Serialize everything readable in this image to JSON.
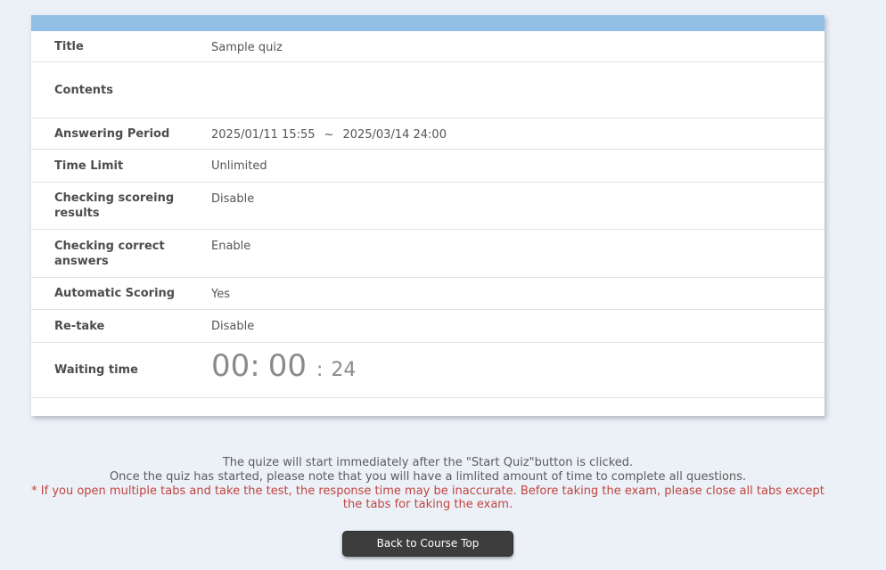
{
  "colors": {
    "page_background": "#ecf0f7",
    "card_header_blue": "#92bfe6",
    "warning_red": "#c0453f",
    "button_background": "#3d3d3d",
    "timer_gray": "#8a8a8a"
  },
  "card": {
    "rows": {
      "title": {
        "label": "Title",
        "value": "Sample quiz"
      },
      "contents": {
        "label": "Contents",
        "value": ""
      },
      "answering_period": {
        "label": "Answering Period",
        "start": "2025/01/11 15:55",
        "separator": "~",
        "end": "2025/03/14 24:00"
      },
      "time_limit": {
        "label": "Time Limit",
        "value": "Unlimited"
      },
      "checking_scoring_results": {
        "label": "Checking scoreing results",
        "value": "Disable"
      },
      "checking_correct_answers": {
        "label": "Checking correct answers",
        "value": "Enable"
      },
      "automatic_scoring": {
        "label": "Automatic Scoring",
        "value": "Yes"
      },
      "retake": {
        "label": "Re-take",
        "value": "Disable"
      },
      "waiting_time": {
        "label": "Waiting time",
        "hours": "00",
        "minutes": "00",
        "seconds": "24",
        "colon": ":"
      }
    }
  },
  "notes": {
    "line1": "The quize will start immediately after the \"Start Quiz\"button is clicked.",
    "line2": "Once the quiz has started, please note that you will have a limlited amount of time to complete all questions.",
    "warning": "* If you open multiple tabs and take the test, the response time may be inaccurate. Before taking the exam, please close all tabs except the tabs for taking the exam."
  },
  "footer": {
    "back_button": "Back to Course Top"
  }
}
